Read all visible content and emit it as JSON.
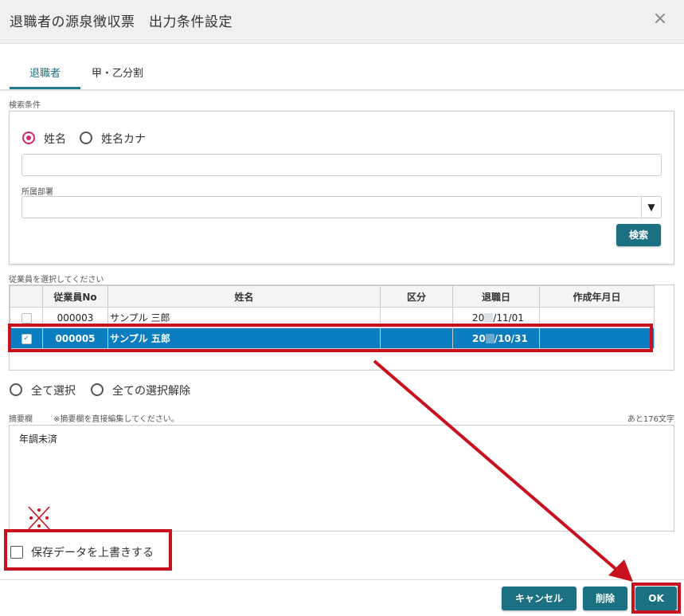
{
  "dialog": {
    "title": "退職者の源泉徴収票　出力条件設定",
    "close_icon": "×"
  },
  "tabs": [
    {
      "label": "退職者",
      "active": true
    },
    {
      "label": "甲・乙分割",
      "active": false
    }
  ],
  "search": {
    "section_label": "検索条件",
    "name_radio": "姓名",
    "kana_radio": "姓名カナ",
    "name_value": "",
    "department_label": "所属部署",
    "department_value": "",
    "dropdown_arrow": "▼",
    "search_button": "検索"
  },
  "employees": {
    "section_label": "従業員を選択してください",
    "columns": [
      "従業員No",
      "姓名",
      "区分",
      "退職日",
      "作成年月日"
    ],
    "rows": [
      {
        "no": "000003",
        "name": "サンプル 三郎",
        "category": "",
        "retire_prefix": "20",
        "retire_suffix": "/11/01",
        "created": "",
        "checked": false,
        "selected": false
      },
      {
        "no": "000005",
        "name": "サンプル 五郎",
        "category": "",
        "retire_prefix": "20",
        "retire_suffix": "/10/31",
        "created": "",
        "checked": true,
        "selected": true
      }
    ],
    "select_all": "全て選択",
    "deselect_all": "全ての選択解除"
  },
  "memo": {
    "label": "摘要欄",
    "note": "※摘要欄を直接編集してください。",
    "remaining": "あと176文字",
    "value": "年調未済"
  },
  "overwrite": {
    "label": "保存データを上書きする",
    "checked": false
  },
  "buttons": {
    "cancel": "キャンセル",
    "delete": "削除",
    "ok": "OK"
  },
  "colors": {
    "accent": "#1b7081",
    "highlight": "#0b7ec1",
    "annotation": "#c8101e",
    "radio": "#d9266b"
  }
}
